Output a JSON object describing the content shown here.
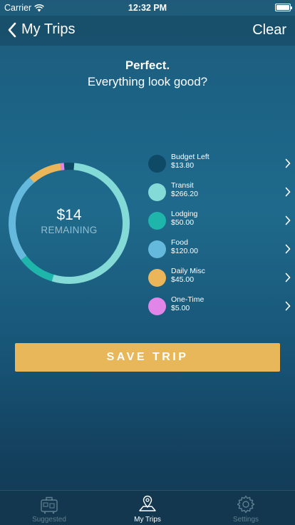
{
  "status_bar": {
    "carrier": "Carrier",
    "time": "12:32 PM"
  },
  "nav": {
    "back_label": "My Trips",
    "clear_label": "Clear"
  },
  "heading": {
    "line1": "Perfect.",
    "line2": "Everything look good?"
  },
  "donut": {
    "amount": "$14",
    "label": "REMAINING"
  },
  "chart_data": {
    "type": "pie",
    "categories": [
      "Budget Left",
      "Transit",
      "Lodging",
      "Food",
      "Daily Misc",
      "One-Time"
    ],
    "values": [
      13.8,
      266.2,
      50.0,
      120.0,
      45.0,
      5.0
    ],
    "colors": [
      "#0e4a66",
      "#83dad6",
      "#1eb5aa",
      "#64b9dc",
      "#ebb55a",
      "#e186e8"
    ]
  },
  "legend": [
    {
      "name": "Budget Left",
      "value": "$13.80",
      "color": "#0e4a66"
    },
    {
      "name": "Transit",
      "value": "$266.20",
      "color": "#83dad6"
    },
    {
      "name": "Lodging",
      "value": "$50.00",
      "color": "#1eb5aa"
    },
    {
      "name": "Food",
      "value": "$120.00",
      "color": "#64b9dc"
    },
    {
      "name": "Daily Misc",
      "value": "$45.00",
      "color": "#ebb55a"
    },
    {
      "name": "One-Time",
      "value": "$5.00",
      "color": "#e186e8"
    }
  ],
  "save_button": {
    "label": "SAVE TRIP"
  },
  "tabs": [
    {
      "label": "Suggested",
      "icon": "luggage-icon",
      "active": false
    },
    {
      "label": "My Trips",
      "icon": "map-pin-icon",
      "active": true
    },
    {
      "label": "Settings",
      "icon": "gear-icon",
      "active": false
    }
  ]
}
